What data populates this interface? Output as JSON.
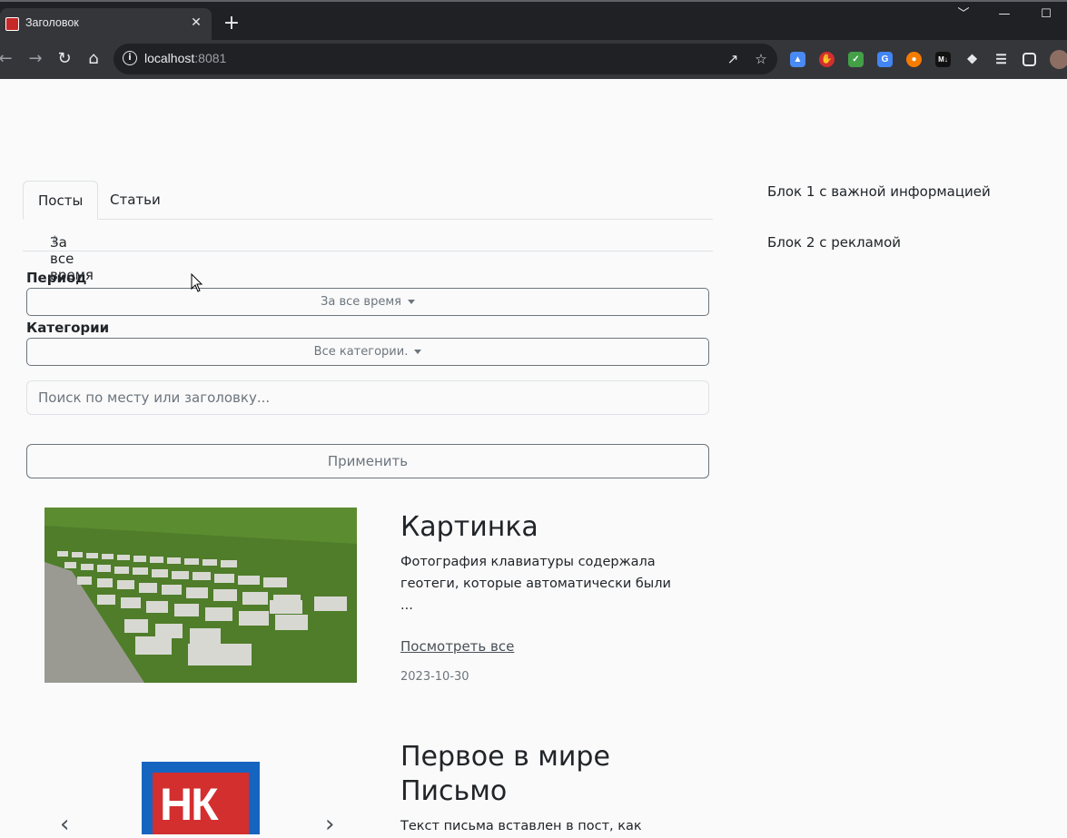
{
  "browser": {
    "tab_title": "Заголовок",
    "tab_close": "✕",
    "new_tab": "+",
    "url_host": "localhost",
    "url_port": ":8081",
    "window_controls": [
      "﹀",
      "—",
      "☐"
    ],
    "extensions": [
      "shield-blue",
      "stop-red",
      "shield-green",
      "translate",
      "rss-orange",
      "markdown",
      "puzzle",
      "media",
      "sidebar"
    ],
    "accent": "#202124"
  },
  "page": {
    "tabs": [
      "Посты",
      "Статьи"
    ],
    "sort_label": "За все время",
    "sort_arrow": "⇧",
    "filters": {
      "period_label": "Период",
      "period_value": "За все время",
      "category_label": "Категории",
      "category_value": "Все категории.",
      "search_placeholder": "Поиск по месту или заголовку...",
      "apply_label": "Применить"
    },
    "posts": [
      {
        "title": "Картинка",
        "excerpt": "Фотография клавиатуры содержала геотеги, которые автоматически были ...",
        "link": "Посмотреть все",
        "date": "2023-10-30"
      },
      {
        "title": "Первое в мире Письмо",
        "excerpt": "Текст письма вставлен в пост, как",
        "logo_text": "НК"
      }
    ],
    "sidebar": {
      "block1": "Блок 1 с важной информацией",
      "block2": "Блок 2 с рекламой"
    }
  }
}
